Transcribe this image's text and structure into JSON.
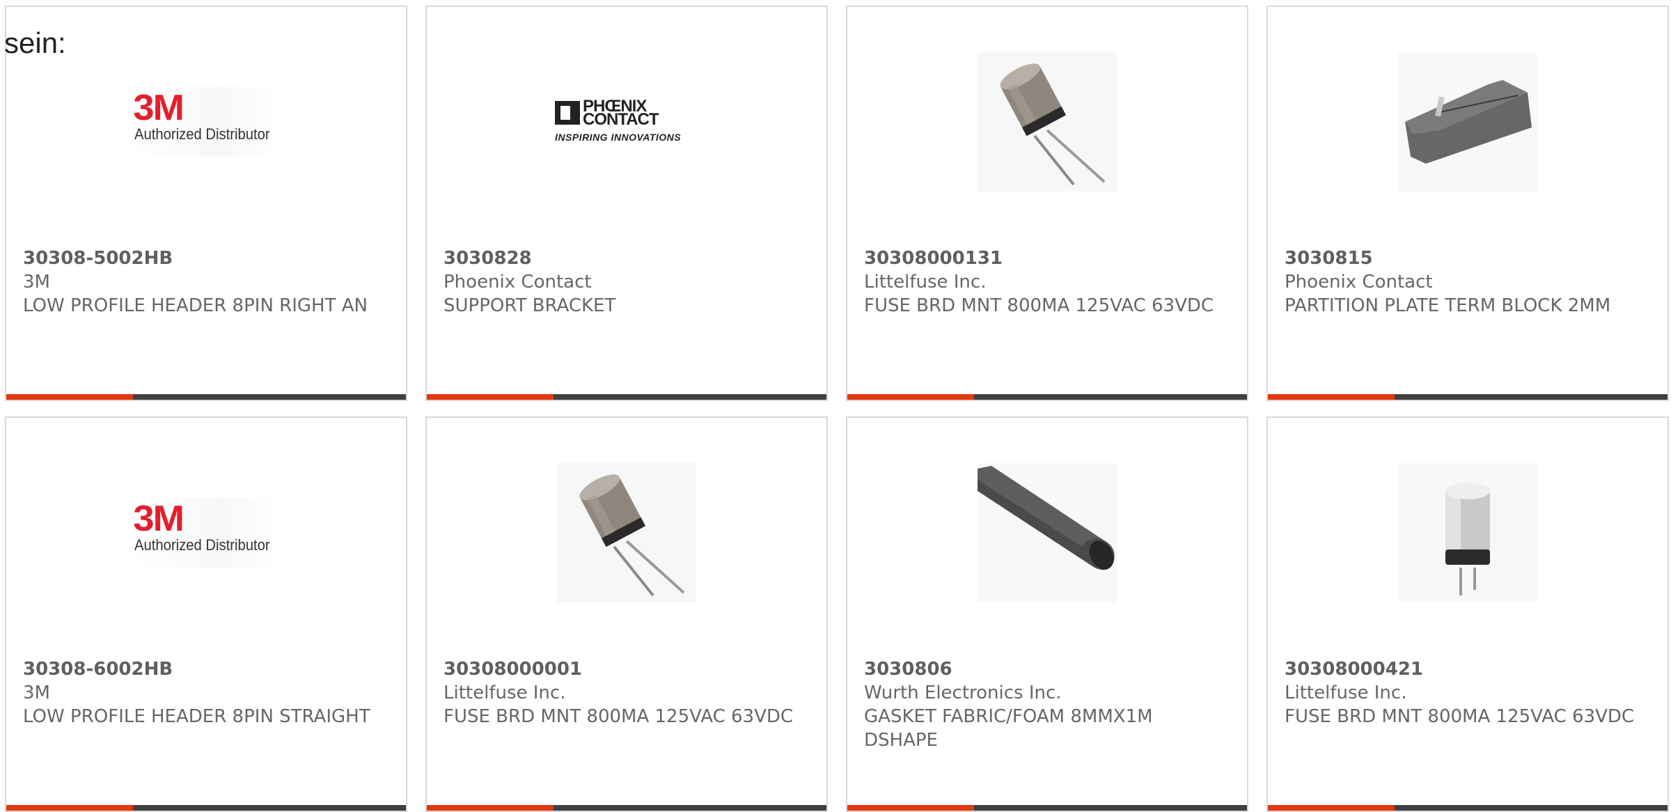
{
  "intro_text": "sein:",
  "colors": {
    "accent": "#e2380e",
    "bar": "#404040",
    "border": "#d9d9d9",
    "text": "#666666"
  },
  "products": [
    {
      "part_number": "30308-5002HB",
      "manufacturer": "3M",
      "description": "LOW PROFILE HEADER 8PIN RIGHT AN",
      "image": "3m-authorized-distributor-logo",
      "logo_brand": "3M",
      "logo_text": "Authorized Distributor"
    },
    {
      "part_number": "3030828",
      "manufacturer": "Phoenix Contact",
      "description": "SUPPORT BRACKET",
      "image": "phoenix-contact-logo",
      "logo_line1": "PHŒNIX",
      "logo_line2": "CONTACT",
      "logo_tagline": "INSPIRING INNOVATIONS"
    },
    {
      "part_number": "30308000131",
      "manufacturer": "Littelfuse Inc.",
      "description": "FUSE BRD MNT 800MA 125VAC 63VDC",
      "image": "radial-fuse-photo"
    },
    {
      "part_number": "3030815",
      "manufacturer": "Phoenix Contact",
      "description": "PARTITION PLATE TERM BLOCK 2MM",
      "image": "partition-plate-photo"
    },
    {
      "part_number": "30308-6002HB",
      "manufacturer": "3M",
      "description": "LOW PROFILE HEADER 8PIN STRAIGHT",
      "image": "3m-authorized-distributor-logo",
      "logo_brand": "3M",
      "logo_text": "Authorized Distributor"
    },
    {
      "part_number": "30308000001",
      "manufacturer": "Littelfuse Inc.",
      "description": "FUSE BRD MNT 800MA 125VAC 63VDC",
      "image": "radial-fuse-photo"
    },
    {
      "part_number": "3030806",
      "manufacturer": "Wurth Electronics Inc.",
      "description": "GASKET FABRIC/FOAM 8MMX1M DSHAPE",
      "image": "gasket-photo"
    },
    {
      "part_number": "30308000421",
      "manufacturer": "Littelfuse Inc.",
      "description": "FUSE BRD MNT 800MA 125VAC 63VDC",
      "image": "upright-fuse-photo"
    }
  ]
}
